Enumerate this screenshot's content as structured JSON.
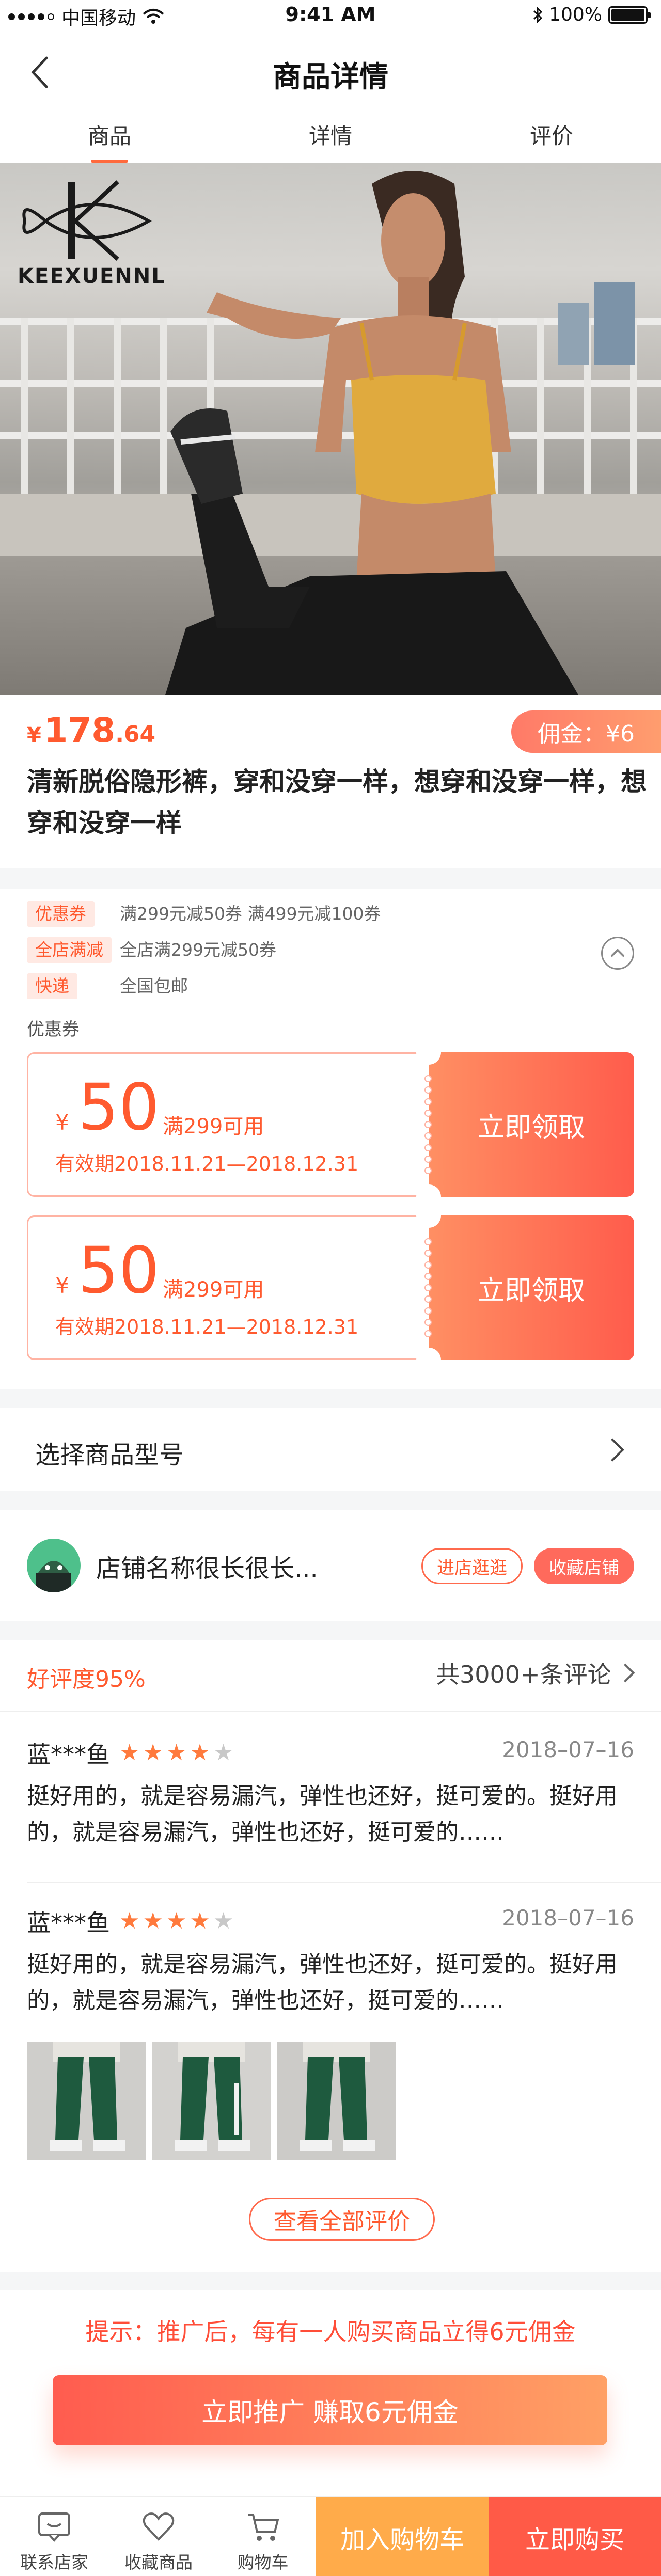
{
  "status_bar": {
    "carrier": "中国移动",
    "time": "9:41 AM",
    "battery": "100%"
  },
  "nav": {
    "title": "商品详情"
  },
  "tabs": [
    {
      "label": "商品",
      "active": true
    },
    {
      "label": "详情"
    },
    {
      "label": "评价"
    }
  ],
  "hero": {
    "brand": "KEEXUENNL"
  },
  "product": {
    "currency": "¥",
    "price_int": "178",
    "price_dec": ".64",
    "commission": "佣金：¥6",
    "title": "清新脱俗隐形裤，穿和没穿一样，想穿和没穿一样，想穿和没穿一样"
  },
  "promos": [
    {
      "tag": "优惠券",
      "text": "满299元减50券     满499元减100券"
    },
    {
      "tag": "全店满减",
      "text": "全店满299元减50券"
    },
    {
      "tag": "快递",
      "text": "全国包邮"
    }
  ],
  "coupons": {
    "label": "优惠券",
    "items": [
      {
        "currency": "¥",
        "amount": "50",
        "condition": "满299可用",
        "validity": "有效期2018.11.21—2018.12.31",
        "action": "立即领取"
      },
      {
        "currency": "¥",
        "amount": "50",
        "condition": "满299可用",
        "validity": "有效期2018.11.21—2018.12.31",
        "action": "立即领取"
      }
    ]
  },
  "select_model": {
    "label": "选择商品型号"
  },
  "shop": {
    "name": "店铺名称很长很长...",
    "visit": "进店逛逛",
    "favorite": "收藏店铺"
  },
  "reviews": {
    "rating": "好评度95%",
    "count": "共3000+条评论",
    "items": [
      {
        "name": "蓝***鱼",
        "stars": 4,
        "date": "2018–07–16",
        "text": "挺好用的，就是容易漏汽，弹性也还好，挺可爱的。挺好用的，就是容易漏汽，弹性也还好，挺可爱的……"
      },
      {
        "name": "蓝***鱼",
        "stars": 4,
        "date": "2018–07–16",
        "text": "挺好用的，就是容易漏汽，弹性也还好，挺可爱的。挺好用的，就是容易漏汽，弹性也还好，挺可爱的……"
      }
    ],
    "view_all": "查看全部评价"
  },
  "promotion": {
    "tip": "提示：推广后，每有一人购买商品立得6元佣金",
    "button": "立即推广 赚取6元佣金"
  },
  "bottom_bar": {
    "contact": "联系店家",
    "favorite": "收藏商品",
    "cart": "购物车",
    "add_to_cart": "加入购物车",
    "buy_now": "立即购买"
  },
  "colors": {
    "accent": "#ff5a2f",
    "orange": "#ffab4a",
    "buy": "#ff5a47"
  }
}
